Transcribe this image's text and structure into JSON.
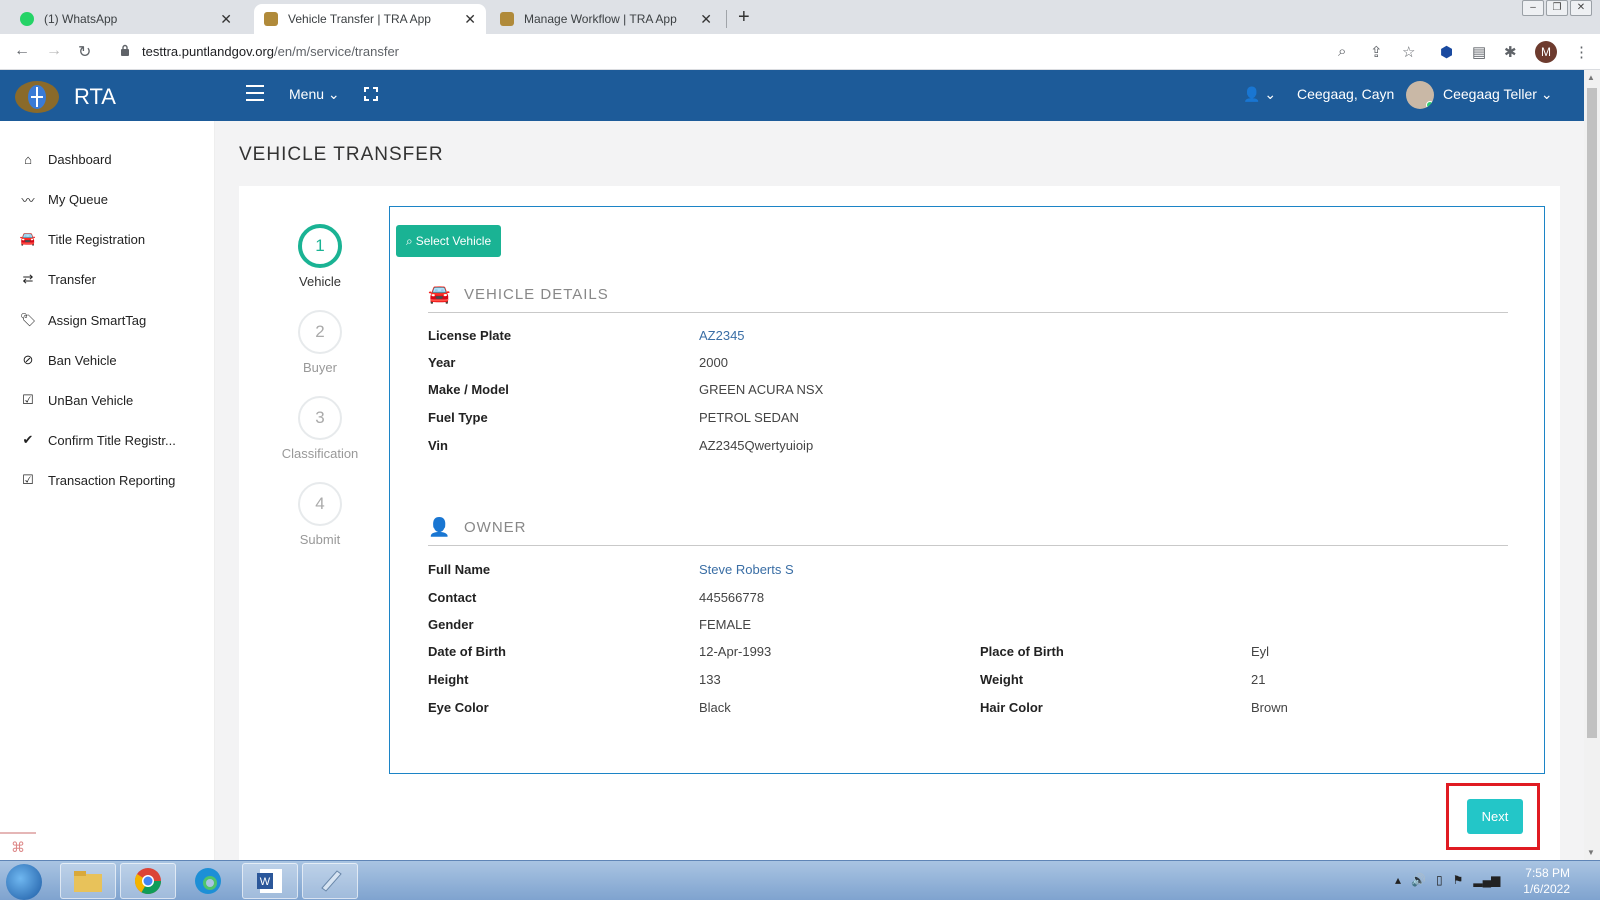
{
  "browser": {
    "tabs": [
      {
        "title": "(1) WhatsApp"
      },
      {
        "title": "Vehicle Transfer | TRA App"
      },
      {
        "title": "Manage Workflow | TRA App"
      }
    ],
    "url_host": "testtra.puntlandgov.org",
    "url_path": "/en/m/service/transfer",
    "profile_initial": "M"
  },
  "header": {
    "brand": "RTA",
    "menu_label": "Menu",
    "user_short": "Ceegaag, Cayn",
    "user_full": "Ceegaag Teller"
  },
  "sidebar": {
    "items": [
      {
        "label": "Dashboard",
        "icon": "home-icon"
      },
      {
        "label": "My Queue",
        "icon": "trend-line-icon"
      },
      {
        "label": "Title Registration",
        "icon": "car-icon"
      },
      {
        "label": "Transfer",
        "icon": "exchange-icon"
      },
      {
        "label": "Assign SmartTag",
        "icon": "tags-icon"
      },
      {
        "label": "Ban Vehicle",
        "icon": "ban-icon"
      },
      {
        "label": "UnBan Vehicle",
        "icon": "check-square-icon"
      },
      {
        "label": "Confirm Title Registr...",
        "icon": "check-icon"
      },
      {
        "label": "Transaction Reporting",
        "icon": "check-square-icon"
      }
    ]
  },
  "page": {
    "title": "VEHICLE TRANSFER",
    "steps": [
      {
        "num": "1",
        "label": "Vehicle"
      },
      {
        "num": "2",
        "label": "Buyer"
      },
      {
        "num": "3",
        "label": "Classification"
      },
      {
        "num": "4",
        "label": "Submit"
      }
    ],
    "select_vehicle_label": "Select Vehicle",
    "vehicle_section": "VEHICLE DETAILS",
    "vehicle": {
      "license_plate_label": "License Plate",
      "license_plate": "AZ2345",
      "year_label": "Year",
      "year": "2000",
      "make_model_label": "Make / Model",
      "make_model": "GREEN ACURA NSX",
      "fuel_type_label": "Fuel Type",
      "fuel_type": "PETROL SEDAN",
      "vin_label": "Vin",
      "vin": "AZ2345Qwertyuioip"
    },
    "owner_section": "OWNER",
    "owner": {
      "full_name_label": "Full Name",
      "full_name": "Steve Roberts S",
      "contact_label": "Contact",
      "contact": "445566778",
      "gender_label": "Gender",
      "gender": "FEMALE",
      "dob_label": "Date of Birth",
      "dob": "12-Apr-1993",
      "pob_label": "Place of Birth",
      "pob": "Eyl",
      "height_label": "Height",
      "height": "133",
      "weight_label": "Weight",
      "weight": "21",
      "eye_label": "Eye Color",
      "eye": "Black",
      "hair_label": "Hair Color",
      "hair": "Brown"
    },
    "next_label": "Next"
  },
  "taskbar": {
    "time": "7:58 PM",
    "date": "1/6/2022"
  },
  "colors": {
    "header_bg": "#1d5b99",
    "step_active": "#1ab394",
    "panel_border": "#1c84c6",
    "next_btn": "#23c6c8",
    "highlight": "#e01b22"
  }
}
